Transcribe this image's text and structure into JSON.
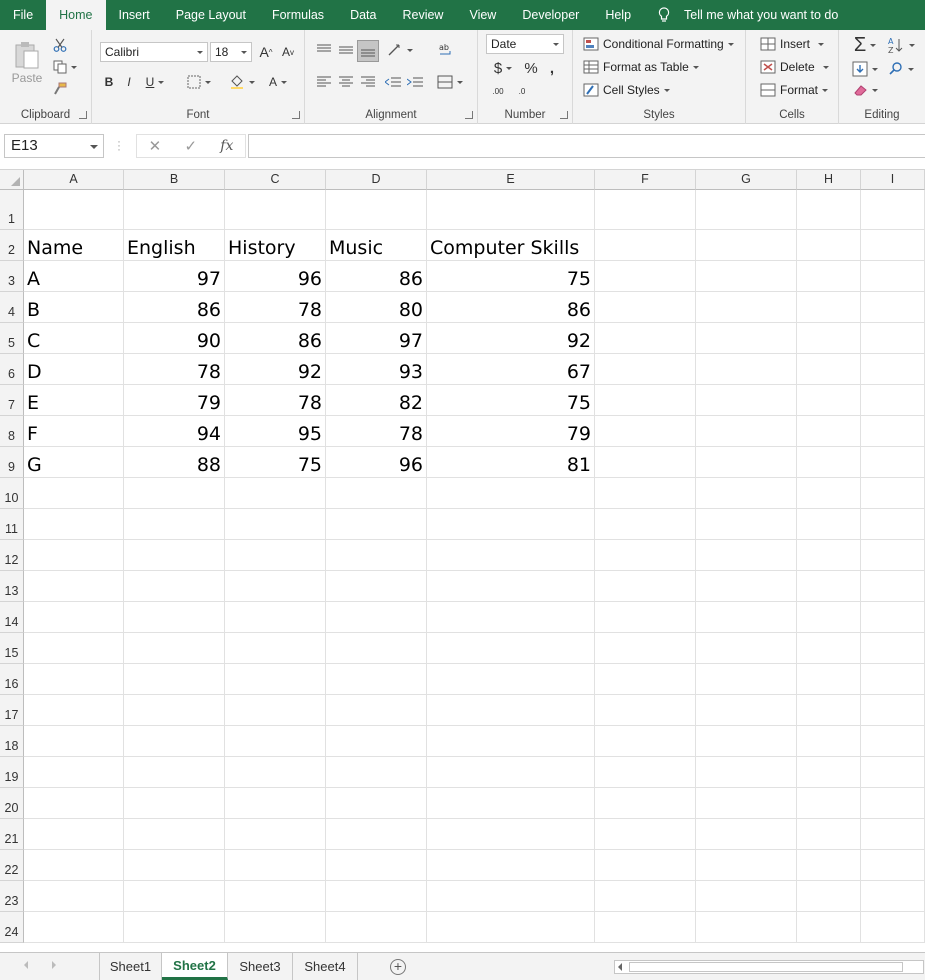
{
  "tabs": [
    {
      "label": "File",
      "active": false
    },
    {
      "label": "Home",
      "active": true
    },
    {
      "label": "Insert",
      "active": false
    },
    {
      "label": "Page Layout",
      "active": false
    },
    {
      "label": "Formulas",
      "active": false
    },
    {
      "label": "Data",
      "active": false
    },
    {
      "label": "Review",
      "active": false
    },
    {
      "label": "View",
      "active": false
    },
    {
      "label": "Developer",
      "active": false
    },
    {
      "label": "Help",
      "active": false
    }
  ],
  "tell_me": "Tell me what you want to do",
  "ribbon": {
    "clipboard": {
      "label": "Clipboard",
      "paste": "Paste"
    },
    "font": {
      "label": "Font",
      "name": "Calibri",
      "size": "18",
      "bold": "B",
      "italic": "I",
      "underline": "U",
      "grow": "A",
      "shrink": "A",
      "font_color": "A"
    },
    "alignment": {
      "label": "Alignment"
    },
    "number": {
      "label": "Number",
      "format": "Date",
      "currency": "$",
      "percent": "%",
      "comma": ",",
      "inc_decimal": ".00",
      "dec_decimal": ".0"
    },
    "styles": {
      "label": "Styles",
      "conditional": "Conditional Formatting",
      "table": "Format as Table",
      "cell_styles": "Cell Styles"
    },
    "cells": {
      "label": "Cells",
      "insert": "Insert",
      "delete": "Delete",
      "format": "Format"
    },
    "editing": {
      "label": "Editing"
    }
  },
  "formula_bar": {
    "name_box": "E13",
    "fx": "fx",
    "value": ""
  },
  "columns": [
    "A",
    "B",
    "C",
    "D",
    "E",
    "F",
    "G",
    "H",
    "I"
  ],
  "rows": [
    "1",
    "2",
    "3",
    "4",
    "5",
    "6",
    "7",
    "8",
    "9",
    "10",
    "11",
    "12",
    "13",
    "14",
    "15",
    "16",
    "17",
    "18",
    "19",
    "20",
    "21",
    "22",
    "23",
    "24"
  ],
  "table": {
    "headers": [
      "Name",
      "English",
      "History",
      "Music",
      "Computer Skills"
    ],
    "records": [
      [
        "A",
        "97",
        "96",
        "86",
        "75"
      ],
      [
        "B",
        "86",
        "78",
        "80",
        "86"
      ],
      [
        "C",
        "90",
        "86",
        "97",
        "92"
      ],
      [
        "D",
        "78",
        "92",
        "93",
        "67"
      ],
      [
        "E",
        "79",
        "78",
        "82",
        "75"
      ],
      [
        "F",
        "94",
        "95",
        "78",
        "79"
      ],
      [
        "G",
        "88",
        "75",
        "96",
        "81"
      ]
    ]
  },
  "sheets": [
    {
      "label": "Sheet1",
      "active": false
    },
    {
      "label": "Sheet2",
      "active": true
    },
    {
      "label": "Sheet3",
      "active": false
    },
    {
      "label": "Sheet4",
      "active": false
    }
  ],
  "colors": {
    "accent": "#217346"
  }
}
